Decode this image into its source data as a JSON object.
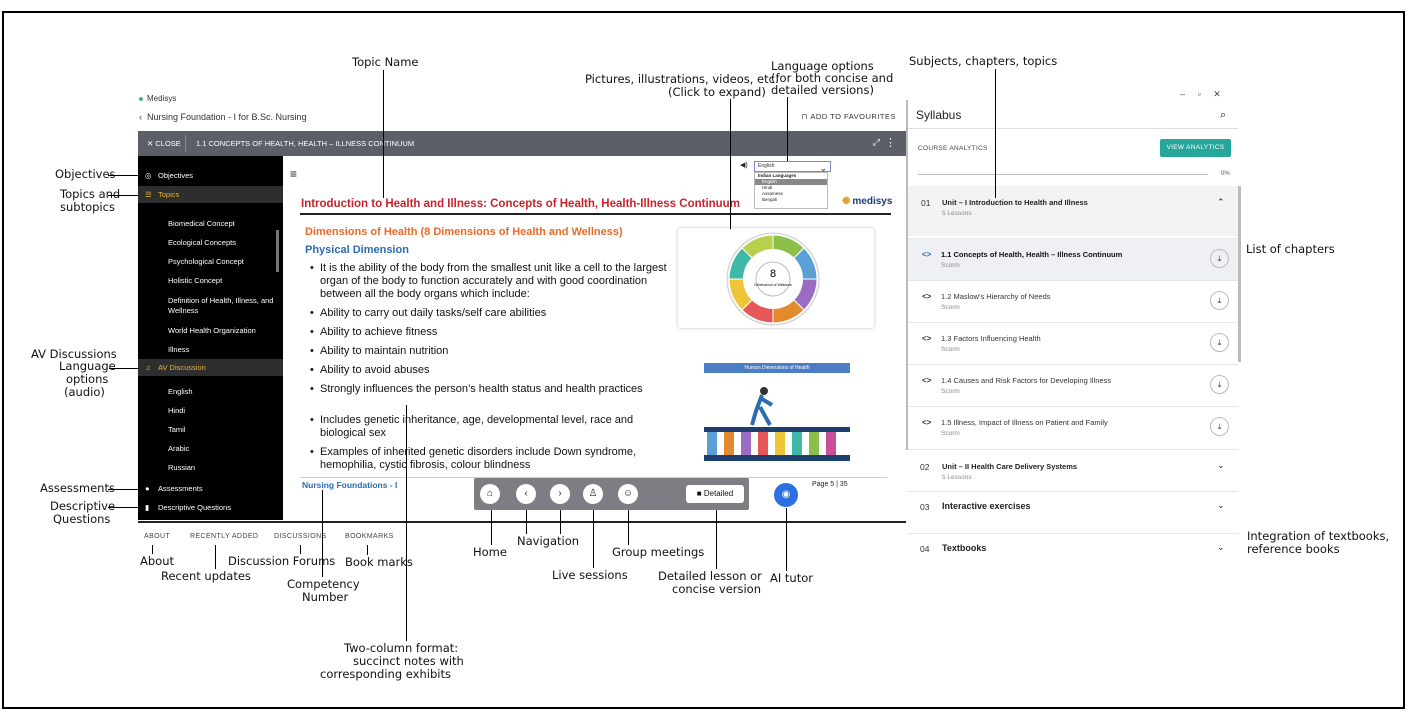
{
  "app": {
    "name": "Medisys",
    "breadcrumb": "Nursing Foundation - I for B.Sc. Nursing",
    "add_to_favourites": "ADD TO FAVOURITES",
    "close_label": "CLOSE",
    "lesson_title": "1.1 CONCEPTS OF HEALTH, HEALTH – ILLNESS CONTINUUM"
  },
  "sidebar": {
    "objectives": "Objectives",
    "topics": "Topics",
    "subtopics": [
      "Biomedical Concept",
      "Ecological Concepts",
      "Psychological Concept",
      "Holistic Concept",
      "Definition of Health, Illness, and Wellness",
      "World Health Organization",
      "Illness"
    ],
    "av_discussion": "AV Discussion",
    "languages": [
      "English",
      "Hindi",
      "Tamil",
      "Arabic",
      "Russian"
    ],
    "assessments": "Assessments",
    "descriptive": "Descriptive Questions"
  },
  "slide": {
    "title": "Introduction to Health and Illness: Concepts of Health, Health-Illness Continuum",
    "brand": "medisys",
    "dimensions_heading": "Dimensions of Health (8 Dimensions of Health and Wellness)",
    "physical_heading": "Physical Dimension",
    "bullets": [
      "It is the ability of the body from the smallest unit like a cell to the largest organ of the body to function accurately and with good coordination between all the body organs which include:",
      "Ability to carry out daily tasks/self care abilities",
      "Ability to achieve fitness",
      "Ability to maintain nutrition",
      "Ability to avoid abuses",
      "Strongly influences the person’s health status and health practices",
      "Includes genetic inheritance, age, developmental level, race and biological sex",
      "Examples of inherited genetic disorders include Down syndrome, hemophilia, cystic fibrosis, colour blindness"
    ],
    "wheel_center_num": "8",
    "wheel_center_text": "Dimensions of Wellness",
    "human_dims_title": "Human Dimensions of Health",
    "footer_left": "Nursing Foundations - I",
    "footer_right": "Page 5 | 35",
    "language_select": "English",
    "language_list": [
      "Indian Languages",
      "English",
      "Hindi",
      "Assamese",
      "Bengali"
    ]
  },
  "toolbar": {
    "detailed": "Detailed"
  },
  "tabs": [
    "ABOUT",
    "RECENTLY ADDED",
    "DISCUSSIONS",
    "BOOKMARKS"
  ],
  "syllabus": {
    "title": "Syllabus",
    "course_analytics": "COURSE ANALYTICS",
    "view_analytics": "VIEW ANALYTICS",
    "progress": "0%",
    "unit1": {
      "num": "01",
      "name": "Unit – I Introduction to Health and Illness",
      "sub": "5 Lessons"
    },
    "chapters": [
      {
        "code": "<>",
        "name": "1.1 Concepts of Health, Health – Illness Continuum",
        "type": "Scorm"
      },
      {
        "code": "<>",
        "name": "1.2 Maslow’s Hierarchy of Needs",
        "type": "Scorm"
      },
      {
        "code": "<>",
        "name": "1.3 Factors Influencing Health",
        "type": "Scorm"
      },
      {
        "code": "<>",
        "name": "1.4 Causes and Risk Factors for Developing Illness",
        "type": "Scorm"
      },
      {
        "code": "<>",
        "name": "1.5 Illness, Impact of Illness on Patient and Family",
        "type": "Scorm"
      }
    ],
    "unit2": {
      "num": "02",
      "name": "Unit – II Health Care Delivery Systems",
      "sub": "5 Lessons"
    },
    "sec3": {
      "num": "03",
      "name": "Interactive exercises"
    },
    "sec4": {
      "num": "04",
      "name": "Textbooks"
    }
  },
  "annotations": {
    "topic_name": "Topic Name",
    "pictures": "Pictures, illustrations, videos, etc.",
    "pictures2": "(Click to expand)",
    "lang_opts1": "Language options",
    "lang_opts2": "(for both concise and",
    "lang_opts3": "detailed versions)",
    "subjects": "Subjects, chapters, topics",
    "objectives": "Objectives",
    "topics1": "Topics and",
    "topics2": "subtopics",
    "av": "AV Discussions",
    "lang_audio1": "Language",
    "lang_audio2": "options",
    "lang_audio3": "(audio)",
    "assessments": "Assessments",
    "descriptive1": "Descriptive",
    "descriptive2": "Questions",
    "about": "About",
    "recent": "Recent updates",
    "forums": "Discussion Forums",
    "bookmarks": "Book marks",
    "competency1": "Competency",
    "competency2": "Number",
    "home": "Home",
    "navigation": "Navigation",
    "group": "Group meetings",
    "live": "Live sessions",
    "detailed1": "Detailed lesson or",
    "detailed2": "concise version",
    "ai": "AI tutor",
    "two_col1": "Two-column format:",
    "two_col2": "succinct notes with",
    "two_col3": "corresponding exhibits",
    "list_chapters": "List of chapters",
    "integration1": "Integration of textbooks,",
    "integration2": "reference books"
  }
}
